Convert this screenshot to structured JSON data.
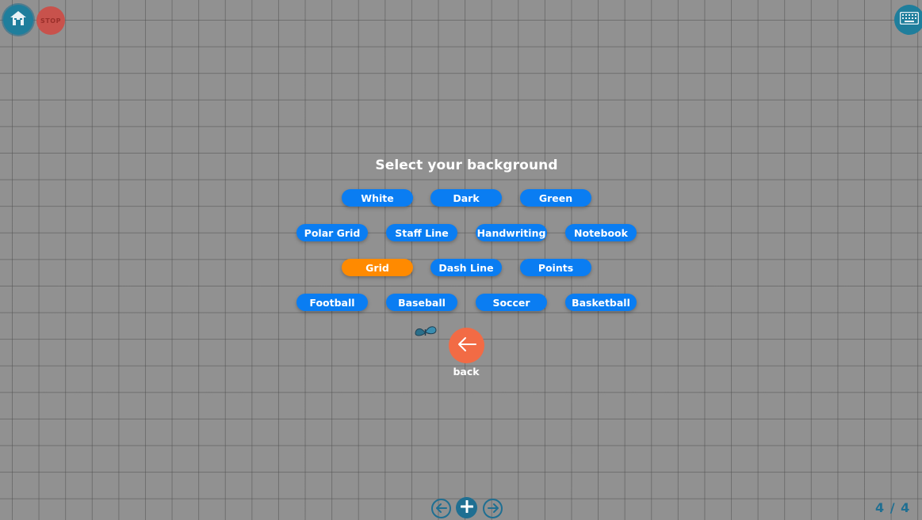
{
  "toolbar": {
    "home_icon": "home-icon",
    "stop_label": "STOP",
    "keyboard_icon": "keyboard-icon"
  },
  "dialog": {
    "title": "Select your background",
    "options": [
      {
        "label": "White"
      },
      {
        "label": "Dark"
      },
      {
        "label": "Green"
      },
      {
        "label": "Polar Grid"
      },
      {
        "label": "Staff Line"
      },
      {
        "label": "Handwriting"
      },
      {
        "label": "Notebook"
      },
      {
        "label": "Grid",
        "selected": true
      },
      {
        "label": "Dash Line"
      },
      {
        "label": "Points"
      },
      {
        "label": "Football"
      },
      {
        "label": "Baseball"
      },
      {
        "label": "Soccer"
      },
      {
        "label": "Basketball"
      }
    ],
    "back_label": "back"
  },
  "pager": {
    "counter": "4 / 4"
  },
  "colors": {
    "button_blue": "#0a7df2",
    "selected_orange": "#ff8a00",
    "back_orange": "#f26b45",
    "teal": "#1f7e9c"
  }
}
